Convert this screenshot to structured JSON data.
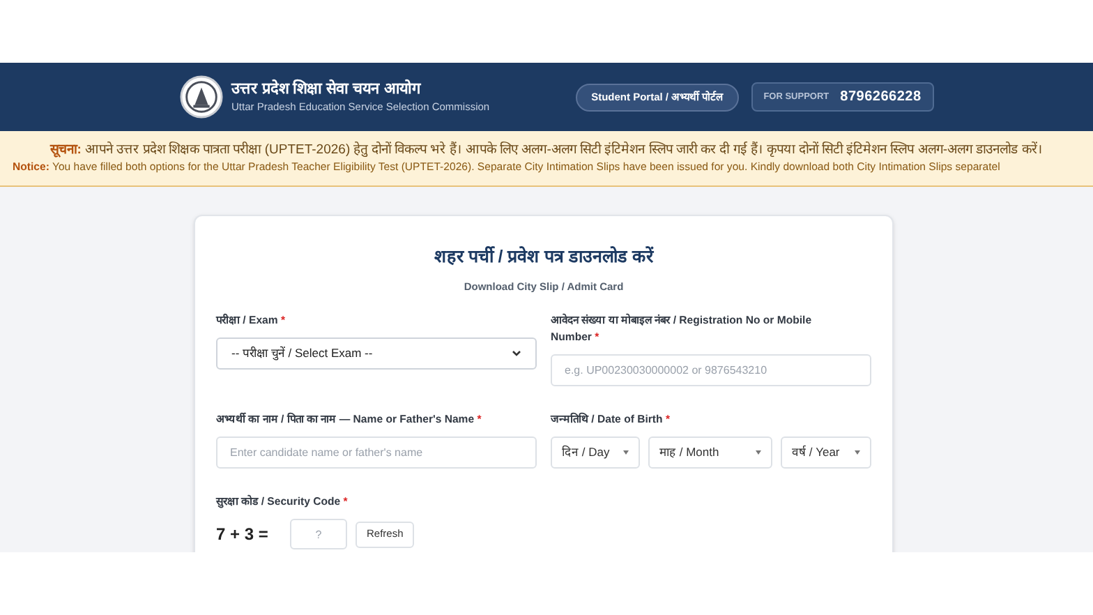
{
  "header": {
    "title_hi": "उत्तर प्रदेश शिक्षा सेवा चयन आयोग",
    "title_en": "Uttar Pradesh Education Service Selection Commission",
    "portal_button": "Student Portal / अभ्यर्थी पोर्टल",
    "support_label": "FOR SUPPORT",
    "support_number": "8796266228"
  },
  "notice": {
    "label_hi": "सूचना:",
    "text_hi": "आपने उत्तर प्रदेश शिक्षक पात्रता परीक्षा (UPTET-2026) हेतु दोनों विकल्प भरे हैं। आपके लिए अलग-अलग सिटी इंटिमेशन स्लिप जारी कर दी गई हैं। कृपया दोनों सिटी इंटिमेशन स्लिप अलग-अलग डाउनलोड करें।",
    "label_en": "Notice:",
    "text_en": "You have filled both options for the Uttar Pradesh Teacher Eligibility Test (UPTET-2026). Separate City Intimation Slips have been issued for you. Kindly download both City Intimation Slips separatel"
  },
  "form": {
    "title": "शहर पर्ची / प्रवेश पत्र डाउनलोड करें",
    "subtitle": "Download City Slip / Admit Card",
    "fields": [
      {
        "kind": "select",
        "label": "परीक्षा / Exam",
        "mark": "*",
        "value": "-- परीक्षा चुनें / Select Exam --"
      },
      {
        "kind": "input",
        "label": "आवेदन संख्या या मोबाइल नंबर / Registration No or Mobile Number",
        "mark": "*",
        "placeholder": "e.g. UP00230030000002 or 9876543210"
      },
      {
        "kind": "input",
        "label": "अभ्यर्थी का नाम / पिता का नाम — Name or Father's Name",
        "mark": "*",
        "placeholder": "Enter candidate name or father's name"
      },
      {
        "kind": "date",
        "label": "जन्मतिथि / Date of Birth",
        "mark": "*",
        "parts": [
          "दिन / Day",
          "माह / Month",
          "वर्ष / Year"
        ]
      }
    ],
    "captcha": {
      "label": "सुरक्षा कोड / Security Code",
      "mark": "*",
      "question": "7 + 3 =",
      "placeholder": "?",
      "refresh": "Refresh"
    }
  }
}
